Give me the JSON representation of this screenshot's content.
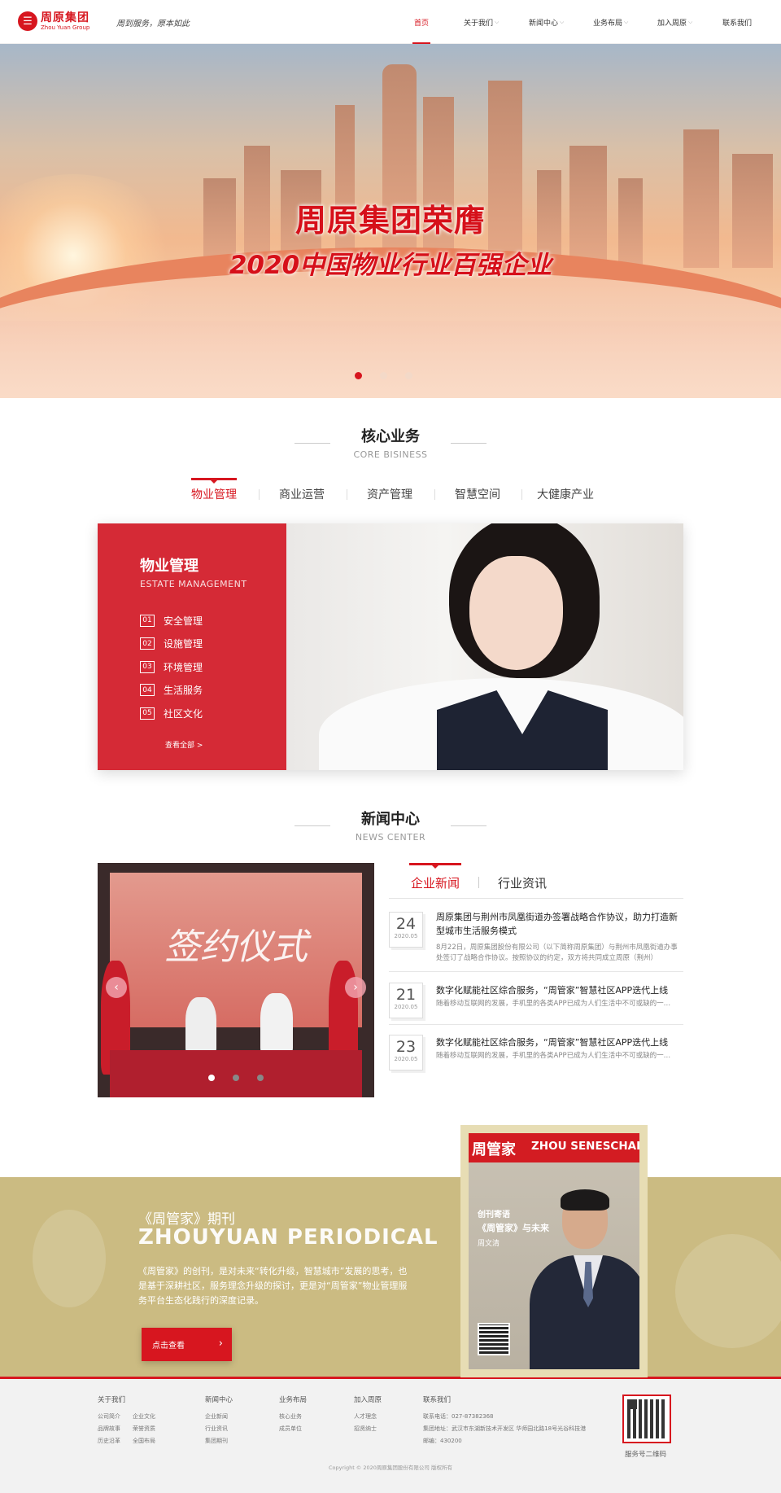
{
  "header": {
    "logo_mark": "☰",
    "logo_cn": "周原集团",
    "logo_en": "Zhou Yuan Group",
    "slogan": "周到服务，原本如此",
    "nav": [
      {
        "label": "首页",
        "active": true,
        "dropdown": false
      },
      {
        "label": "关于我们",
        "active": false,
        "dropdown": true
      },
      {
        "label": "新闻中心",
        "active": false,
        "dropdown": true
      },
      {
        "label": "业务布局",
        "active": false,
        "dropdown": true
      },
      {
        "label": "加入周原",
        "active": false,
        "dropdown": true
      },
      {
        "label": "联系我们",
        "active": false,
        "dropdown": false
      }
    ]
  },
  "banner": {
    "title1": "周原集团荣膺",
    "title2": "2020中国物业行业百强企业",
    "slide_count": 3,
    "active_slide": 1
  },
  "core": {
    "title_cn": "核心业务",
    "title_en": "CORE BISINESS",
    "tabs": [
      "物业管理",
      "商业运营",
      "资产管理",
      "智慧空间",
      "大健康产业"
    ],
    "active_tab": 0,
    "panel": {
      "title_cn": "物业管理",
      "title_en": "ESTATE  MANAGEMENT",
      "items": [
        {
          "num": "01",
          "label": "安全管理"
        },
        {
          "num": "02",
          "label": "设施管理"
        },
        {
          "num": "03",
          "label": "环境管理"
        },
        {
          "num": "04",
          "label": "生活服务"
        },
        {
          "num": "05",
          "label": "社区文化"
        }
      ],
      "more": "查看全部 >"
    }
  },
  "news": {
    "title_cn": "新闻中心",
    "title_en": "NEWS CENTER",
    "photo_text": "签约仪式",
    "tabs": [
      "企业新闻",
      "行业资讯"
    ],
    "active_tab": 0,
    "items": [
      {
        "day": "24",
        "ym": "2020.05",
        "title": "周原集团与荆州市凤凰街道办签署战略合作协议，助力打造新型城市生活服务模式",
        "desc": "8月22日，周原集团股份有限公司（以下简称周原集团）与荆州市凤凰街道办事处签订了战略合作协议。按照协议的约定，双方将共同成立周原（荆州）"
      },
      {
        "day": "21",
        "ym": "2020.05",
        "title": "数字化赋能社区综合服务，“周管家”智慧社区APP迭代上线",
        "desc": "随着移动互联网的发展，手机里的各类APP已成为人们生活中不可或缺的一…"
      },
      {
        "day": "23",
        "ym": "2020.05",
        "title": "数字化赋能社区综合服务，“周管家”智慧社区APP迭代上线",
        "desc": "随着移动互联网的发展，手机里的各类APP已成为人们生活中不可或缺的一…"
      }
    ]
  },
  "periodical": {
    "title_cn": "《周管家》期刊",
    "title_en": "ZHOUYUAN  PERIODICAL",
    "desc": "《周管家》的创刊，是对未来“转化升级，智慧城市”发展的思考，也是基于深耕社区，服务理念升级的探讨，更是对“周管家”物业管理服务平台生态化践行的深度记录。",
    "button": "点击查看",
    "magazine": {
      "logo": "周管家",
      "en": "ZHOU SENESCHAL",
      "sub1": "创刊寄语",
      "sub2": "《周管家》与未来",
      "sub3": "周文清"
    }
  },
  "footer": {
    "columns": [
      {
        "title": "关于我们",
        "links": [
          "公司简介",
          "企业文化",
          "品牌故事",
          "荣誉资质",
          "历史沿革",
          "全国布局"
        ]
      },
      {
        "title": "新闻中心",
        "links": [
          "企业新闻",
          "行业资讯",
          "集团期刊"
        ]
      },
      {
        "title": "业务布局",
        "links": [
          "核心业务",
          "成员单位"
        ]
      },
      {
        "title": "加入周原",
        "links": [
          "人才理念",
          "招贤纳士"
        ]
      },
      {
        "title": "联系我们",
        "links": [
          "联系电话：027-87382368",
          "集团地址：武汉市东湖新技术开发区 华师园北路18号光谷科技港",
          "邮编：430200"
        ]
      }
    ],
    "qr_caption": "服务号二维码",
    "copyright": "Copyright © 2020周原集团股份有限公司 版权所有"
  },
  "colors": {
    "brand_red": "#d7161f",
    "panel_red": "#d52a36",
    "periodical_gold": "#cbbb82"
  }
}
